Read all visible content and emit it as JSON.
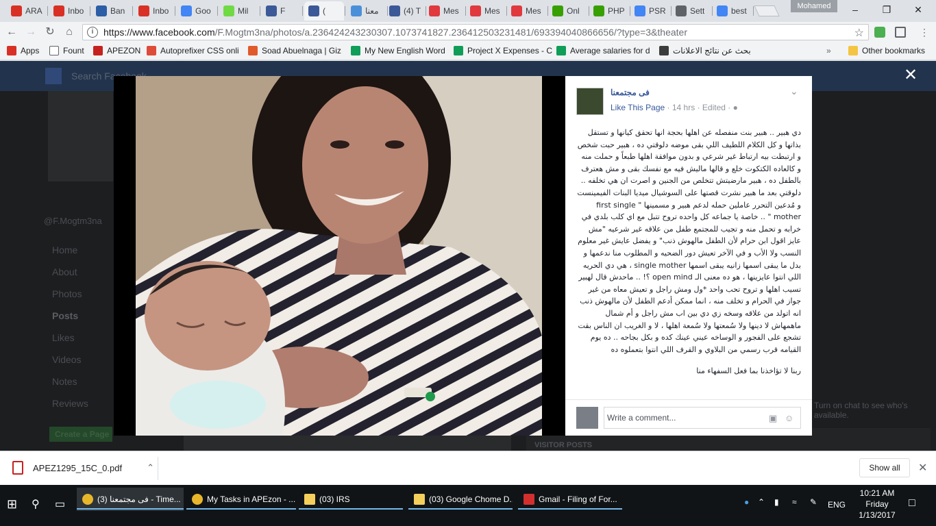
{
  "browser": {
    "tabs": [
      {
        "label": "ARA",
        "icon": "gmail-icon",
        "color": "#d93025"
      },
      {
        "label": "Inbo",
        "icon": "gmail-icon",
        "color": "#d93025"
      },
      {
        "label": "Ban",
        "icon": "bank-icon",
        "color": "#2b5ea7"
      },
      {
        "label": "Inbo",
        "icon": "gmail-icon",
        "color": "#d93025"
      },
      {
        "label": "Goo",
        "icon": "google-translate-icon",
        "color": "#4285f4"
      },
      {
        "label": "Mil",
        "icon": "upwork-icon",
        "color": "#6fda44"
      },
      {
        "label": "F",
        "icon": "facebook-icon",
        "color": "#3b5998"
      },
      {
        "label": "(",
        "icon": "facebook-icon",
        "color": "#3b5998"
      },
      {
        "label": "معنا",
        "icon": "loading-icon",
        "color": "#4a90d9"
      },
      {
        "label": "(4) T",
        "icon": "facebook-icon",
        "color": "#3b5998"
      },
      {
        "label": "Mes",
        "icon": "meetup-icon",
        "color": "#e0393e"
      },
      {
        "label": "Mes",
        "icon": "meetup-icon",
        "color": "#e0393e"
      },
      {
        "label": "Mes",
        "icon": "meetup-icon",
        "color": "#e0393e"
      },
      {
        "label": "Onl",
        "icon": "upwork-icon",
        "color": "#37a000"
      },
      {
        "label": "PHP",
        "icon": "upwork-icon",
        "color": "#37a000"
      },
      {
        "label": "PSR",
        "icon": "google-icon",
        "color": "#4285f4"
      },
      {
        "label": "Sett",
        "icon": "gear-icon",
        "color": "#5f6368"
      },
      {
        "label": "best",
        "icon": "google-icon",
        "color": "#4285f4"
      }
    ],
    "profile_name": "Mohamed",
    "url_host": "https://www.facebook.com",
    "url_path": "/F.Mogtm3na/photos/a.236424243230307.1073741827.236412503231481/693394040866656/?type=3&theater"
  },
  "bookmarks": [
    {
      "label": "Apps",
      "color": "#d93025"
    },
    {
      "label": "Fount",
      "color": "#ffffff"
    },
    {
      "label": "APEZON",
      "color": "#c5221f"
    },
    {
      "label": "Autoprefixer CSS onli",
      "color": "#dd4b39"
    },
    {
      "label": "Soad Abuelnaga | Giz",
      "color": "#e05a2b"
    },
    {
      "label": "My New English Word",
      "color": "#0f9d58"
    },
    {
      "label": "Project X Expenses - C",
      "color": "#0f9d58"
    },
    {
      "label": "Average salaries for d",
      "color": "#0f9d58"
    },
    {
      "label": "بحث عن نتائج الاعلانات",
      "color": "#3c3c3c"
    },
    {
      "label": "Other bookmarks",
      "color": "#f4c542"
    }
  ],
  "fb_background": {
    "search_placeholder": "Search Facebook",
    "handle": "@F.Mogtm3na",
    "nav": [
      "Home",
      "About",
      "Photos",
      "Posts",
      "Likes",
      "Videos",
      "Notes",
      "Reviews"
    ],
    "create_page": "Create a Page",
    "visitor_posts": "VISITOR POSTS",
    "chat_notice": "Turn on chat to see who's available."
  },
  "post": {
    "page_name": "فى مجتمعنا",
    "like_page": "Like This Page",
    "time": "14 hrs",
    "edited": "Edited",
    "paragraph1": "دي هبير .. هبير بنت منفصله عن اهلها بحجة انها تحقق كيانها و تستقل بذاتها و كل الكلام اللطيف اللي بقى موضه دلوقتي ده ، هبير حبت شخص و ارتبطت بيه ارتباط غير شرعي و بدون موافقة اهلها طبعاً و حملت منه و كالعاده الكتكوت خلع و قالها ماليش فيه مع نفسك بقى و مش هعترف بالطفل ده ، هبير مارضيتش تتخلص من الجنين و اصرت ان هي تخلفه .. دلوقتي بعد ما هبير نشرت قصتها على السوشيال ميديا البنات الفيمينست و مُدعين التحرر عاملين حمله لدعم هبير و مسمينها \" first single mother \" .. خاصة يا جماعه كل واحده تروح تتبل مع اي كلب بلدي في خرابه و تحمل منه و تجيب للمجتمع طفل من علاقه غير شرعيه \"مش عايز اقول ابن حرام لأن الطفل مالهوش ذنب\" و يفضل عايش غير معلوم النسب ولا الأب و في الآخر تعيش دور الضحيه و المطلوب منا ندعمها و بدل ما يبقى اسمها زانيه يبقى اسمها single mother ، هي دي الحريه اللي انتوا عايزينها ، هو ده معنى الـ open mind ؟! .. ماحدش قال لهبير تسيب اهلها و تروح تحب واحد *ول ومش راجل و تعيش معاه من غير جواز في الحرام و تخلف منه ، انما ممكن أدعم الطفل لأن مالهوش ذنب انه اتولد من علاقه وسخه زي دي بين اب مش راجل و أم شمال ماهمهاش لا دينها ولا سُمعتها ولا سُمعة اهلها ، لا و الغريب ان الناس بقت تشجع على الفجور و الوساخه عيني عينك كده و بكل بجاحه .. ده يوم القيامه قرب رسمي من البلاوي و القرف اللي انتوا بتعملوه ده",
    "paragraph2": "ربنا لا تؤاخذنا بما فعل السفهاء منا",
    "comment_placeholder": "Write a comment..."
  },
  "downloads": {
    "file_name": "APEZ1295_15C_0.pdf",
    "show_all": "Show all"
  },
  "taskbar": {
    "tasks": [
      {
        "label": "(3) فى مجتمعنا - Time...",
        "icon": "chrome-icon"
      },
      {
        "label": "My Tasks in APEzon - ...",
        "icon": "chrome-icon"
      },
      {
        "label": "(03) IRS",
        "icon": "folder-icon"
      },
      {
        "label": "(03) Google Chome D...",
        "icon": "folder-icon"
      },
      {
        "label": "Gmail - Filing of For...",
        "icon": "pdf-icon"
      }
    ],
    "language": "ENG",
    "time": "10:21 AM",
    "day": "Friday",
    "date": "1/13/2017"
  }
}
